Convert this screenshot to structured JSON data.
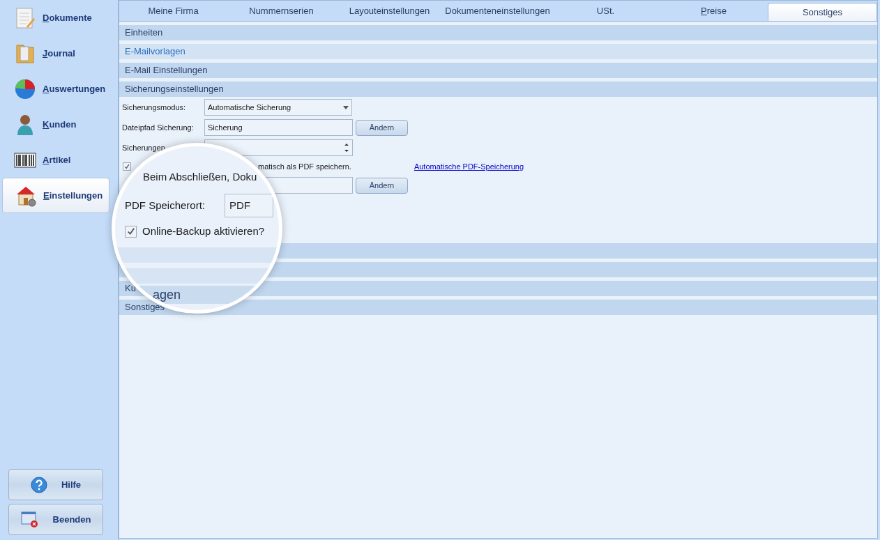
{
  "sidebar": {
    "items": [
      {
        "label": "Dokumente",
        "kind": "document",
        "selected": false
      },
      {
        "label": "Journal",
        "kind": "folder",
        "selected": false
      },
      {
        "label": "Auswertungen",
        "kind": "pie",
        "selected": false
      },
      {
        "label": "Kunden",
        "kind": "person",
        "selected": false
      },
      {
        "label": "Artikel",
        "kind": "barcode",
        "selected": false
      },
      {
        "label": "Einstellungen",
        "kind": "house",
        "selected": true
      }
    ],
    "buttons": [
      {
        "label": "Hilfe",
        "kind": "help"
      },
      {
        "label": "Beenden",
        "kind": "exit"
      }
    ]
  },
  "tabs": [
    {
      "label": "Meine Firma",
      "selected": false,
      "mnemonic": false
    },
    {
      "label": "Nummernserien",
      "selected": false,
      "mnemonic": false
    },
    {
      "label": "Layouteinstellungen",
      "selected": false,
      "mnemonic": false
    },
    {
      "label": "Dokumenteneinstellungen",
      "selected": false,
      "mnemonic": false
    },
    {
      "label": "USt.",
      "selected": false,
      "mnemonic": false
    },
    {
      "label": "Preise",
      "selected": false,
      "mnemonic": true
    },
    {
      "label": "Sonstiges",
      "selected": true,
      "mnemonic": false
    }
  ],
  "sections_top": [
    {
      "title": "Einheiten",
      "hovered": false
    },
    {
      "title": "E-Mailvorlagen",
      "hovered": true
    },
    {
      "title": "E-Mail Einstellungen",
      "hovered": false
    },
    {
      "title": "Sicherungseinstellungen",
      "hovered": false
    }
  ],
  "backup": {
    "mode_label": "Sicherungsmodus:",
    "mode_value": "Automatische Sicherung",
    "path_label": "Dateipfad Sicherung:",
    "path_value": "Sicherung",
    "path_button": "Ändern",
    "keep_label": "Sicherungen",
    "pdf_checked": true,
    "pdf_text": "matisch als PDF speichern.",
    "pdf_link": "Automatische PDF-Speicherung",
    "pdf_button": "Ändern"
  },
  "sections_bottom": [
    {
      "kind": "untitled"
    },
    {
      "kind": "untitled"
    },
    {
      "kind": "titled",
      "title": "Ku"
    },
    {
      "kind": "titled",
      "title": "Sonstiges"
    }
  ],
  "magnifier": {
    "text": "Beim Abschließen, Doku",
    "pdf_label": "PDF Speicherort:",
    "pdf_value": "PDF",
    "online_backup": {
      "label": "Online-Backup aktivieren?",
      "checked": true
    },
    "section_fragment": "agen"
  }
}
